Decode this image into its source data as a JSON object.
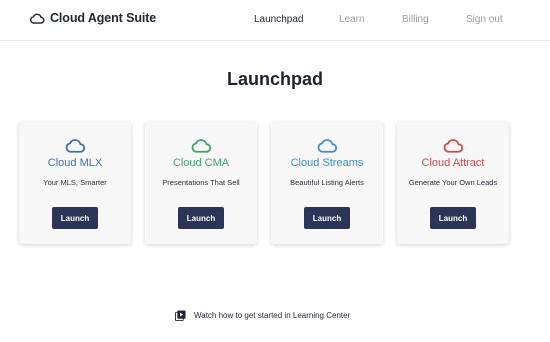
{
  "header": {
    "brand_name": "Cloud Agent Suite",
    "nav": {
      "launchpad": "Launchpad",
      "learn": "Learn",
      "billing": "Billing",
      "sign_out": "Sign out"
    }
  },
  "main": {
    "title": "Launchpad",
    "cards": [
      {
        "name": "Cloud MLX",
        "tagline": "Your MLS, Smarter",
        "button": "Launch",
        "color": "#3d6fb6",
        "icon": "cloud-icon"
      },
      {
        "name": "Cloud CMA",
        "tagline": "Presentations That Sell",
        "button": "Launch",
        "color": "#3fa46a",
        "icon": "cloud-icon"
      },
      {
        "name": "Cloud Streams",
        "tagline": "Beautiful Listing Alerts",
        "button": "Launch",
        "color": "#3f8fc9",
        "icon": "cloud-icon"
      },
      {
        "name": "Cloud Attract",
        "tagline": "Generate Your Own Leads",
        "button": "Launch",
        "color": "#d9484a",
        "icon": "cloud-icon"
      }
    ]
  },
  "footer": {
    "learning_link": "Watch how to get started in Learning Center",
    "icon": "video-play-icon"
  },
  "colors": {
    "navy": "#2c3457",
    "muted_nav": "#9a9ca6"
  }
}
